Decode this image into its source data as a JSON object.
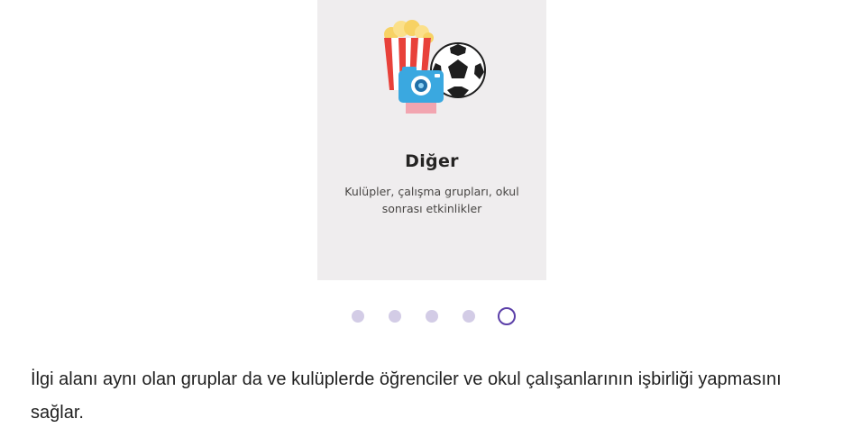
{
  "card": {
    "title": "Diğer",
    "description": "Kulüpler, çalışma grupları, okul sonrası etkinlikler",
    "illustration_icons": [
      "popcorn-icon",
      "camera-icon",
      "soccer-ball-icon"
    ]
  },
  "carousel": {
    "total_pages": 5,
    "active_index": 4
  },
  "description_text": "İlgi alanı aynı olan gruplar da ve kulüplerde öğrenciler ve okul çalışanlarının işbirliği yapmasını sağlar.",
  "colors": {
    "card_background": "#efedee",
    "dot_inactive": "#d3cce6",
    "dot_active_border": "#5b3fa8"
  }
}
